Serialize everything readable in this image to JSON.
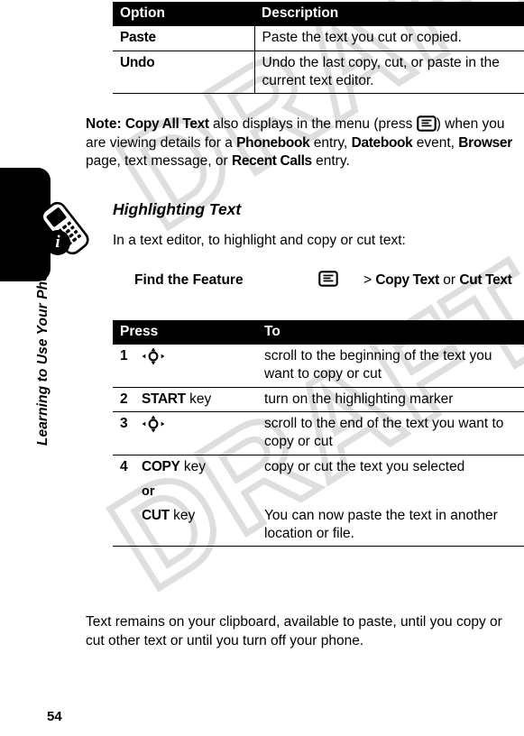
{
  "document": {
    "page_number": "54",
    "sidebar_title": "Learning to Use Your Phone",
    "watermark": "DRAFT"
  },
  "icons": {
    "menu_key": "menu-key-icon",
    "nav_key": "navigation-key-icon",
    "phone": "phone-icon",
    "info": "info-badge-icon",
    "info_letter": "i"
  },
  "options_table": {
    "headers": [
      "Option",
      "Description"
    ],
    "rows": [
      {
        "option": "Paste",
        "description": "Paste the text you cut or copied."
      },
      {
        "option": "Undo",
        "description": "Undo the last copy, cut, or paste in the current text editor."
      }
    ]
  },
  "note": {
    "label": "Note:",
    "term": "Copy All Text",
    "text_1": " also displays in the menu (press ",
    "text_2": ") when you are viewing details for a ",
    "term_2": "Phonebook",
    "text_3": " entry, ",
    "term_3": "Datebook",
    "text_4": " event, ",
    "term_4": "Browser",
    "text_5": " page, text message, or ",
    "term_5": "Recent Calls",
    "text_6": " entry."
  },
  "section": {
    "heading": "Highlighting Text",
    "intro": "In a text editor, to highlight and copy or cut text:"
  },
  "find_feature": {
    "label": "Find the Feature",
    "separator": "> ",
    "option_1": "Copy Text",
    "conjunction": " or ",
    "option_2": "Cut Text"
  },
  "press_table": {
    "headers": [
      "Press",
      "To"
    ],
    "rows": [
      {
        "number": "1",
        "press_icon": "navigation-key-icon",
        "press_text": "",
        "press_suffix": "",
        "to": "scroll to the beginning of the text you want to copy or cut"
      },
      {
        "number": "2",
        "press_icon": "",
        "press_text": "START",
        "press_suffix": " key",
        "to": "turn on the highlighting marker"
      },
      {
        "number": "3",
        "press_icon": "navigation-key-icon",
        "press_text": "",
        "press_suffix": "",
        "to": "scroll to the end of the text you want to copy or cut"
      },
      {
        "number": "4",
        "press_icon": "",
        "press_text": "COPY",
        "press_suffix": " key",
        "press_or": "or",
        "press_text_2": "CUT",
        "press_suffix_2": " key",
        "to": "copy or cut the text you selected",
        "to_2": "You can now paste the text in another location or file."
      }
    ]
  },
  "closing": {
    "text": "Text remains on your clipboard, available to paste, until you copy or cut other text or until you turn off your phone."
  }
}
